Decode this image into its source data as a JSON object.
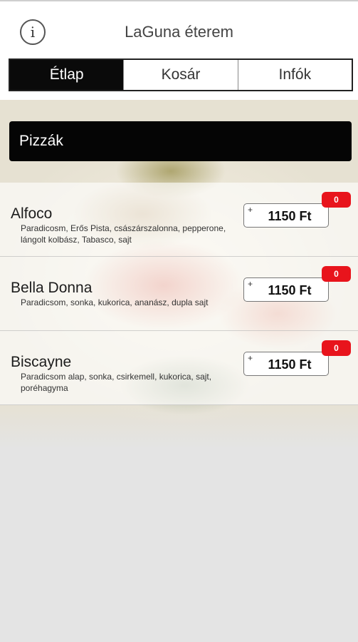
{
  "header": {
    "title": "LaGuna éterem",
    "info_icon": "info-icon",
    "info_glyph": "i"
  },
  "tabs": [
    {
      "label": "Étlap",
      "active": true
    },
    {
      "label": "Kosár",
      "active": false
    },
    {
      "label": "Infók",
      "active": false
    }
  ],
  "category": {
    "title": "Pizzák"
  },
  "items": [
    {
      "name": "Alfoco",
      "description": "Paradicosm, Erős Pista, császárszalonna, pepperone, lángolt kolbász, Tabasco, sajt",
      "price": "1150 Ft",
      "count": "0",
      "plus": "+"
    },
    {
      "name": "Bella Donna",
      "description": "Paradicsom, sonka, kukorica, ananász, dupla sajt",
      "price": "1150 Ft",
      "count": "0",
      "plus": "+"
    },
    {
      "name": "Biscayne",
      "description": "Paradicsom alap, sonka, csirkemell, kukorica, sajt, poréhagyma",
      "price": "1150 Ft",
      "count": "0",
      "plus": "+"
    }
  ],
  "colors": {
    "active_tab": "#0a0a0a",
    "badge": "#e8141c",
    "category_bar": "#050505"
  }
}
